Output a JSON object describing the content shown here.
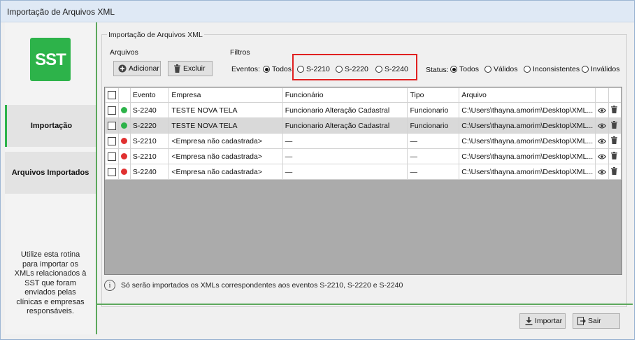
{
  "window": {
    "title": "Importação de Arquivos XML"
  },
  "sidebar": {
    "logo_text": "SST",
    "items": [
      {
        "label": "Importação",
        "active": true
      },
      {
        "label": "Arquivos Importados",
        "active": false
      }
    ],
    "help_lines": [
      "Utilize esta rotina",
      "para importar os",
      "XMLs relacionados à",
      "SST que foram",
      "enviados pelas",
      "clínicas e empresas",
      "responsáveis."
    ]
  },
  "group": {
    "title": "Importação de Arquivos XML",
    "arquivos_legend": "Arquivos",
    "filtros_legend": "Filtros",
    "add_label": "Adicionar",
    "delete_label": "Excluir",
    "eventos_label": "Eventos:",
    "eventos": [
      {
        "label": "Todos",
        "selected": true
      },
      {
        "label": "S-2210",
        "selected": false
      },
      {
        "label": "S-2220",
        "selected": false
      },
      {
        "label": "S-2240",
        "selected": false
      }
    ],
    "status_label": "Status:",
    "status": [
      {
        "label": "Todos",
        "selected": true
      },
      {
        "label": "Válidos",
        "selected": false
      },
      {
        "label": "Inconsistentes",
        "selected": false
      },
      {
        "label": "Inválidos",
        "selected": false
      }
    ]
  },
  "table": {
    "columns": [
      "Evento",
      "Empresa",
      "Funcionário",
      "Tipo",
      "Arquivo"
    ],
    "rows": [
      {
        "status": "green",
        "evento": "S-2240",
        "empresa": "TESTE NOVA TELA",
        "funcionario": "Funcionario Alteração Cadastral",
        "tipo": "Funcionario",
        "arquivo": "C:\\Users\\thayna.amorim\\Desktop\\XML...",
        "selected": false
      },
      {
        "status": "green",
        "evento": "S-2220",
        "empresa": "TESTE NOVA TELA",
        "funcionario": "Funcionario Alteração Cadastral",
        "tipo": "Funcionario",
        "arquivo": "C:\\Users\\thayna.amorim\\Desktop\\XML...",
        "selected": true
      },
      {
        "status": "red",
        "evento": "S-2210",
        "empresa": "<Empresa não cadastrada>",
        "funcionario": "—",
        "tipo": "—",
        "arquivo": "C:\\Users\\thayna.amorim\\Desktop\\XML...",
        "selected": false
      },
      {
        "status": "red",
        "evento": "S-2210",
        "empresa": "<Empresa não cadastrada>",
        "funcionario": "—",
        "tipo": "—",
        "arquivo": "C:\\Users\\thayna.amorim\\Desktop\\XML...",
        "selected": false
      },
      {
        "status": "red",
        "evento": "S-2240",
        "empresa": "<Empresa não cadastrada>",
        "funcionario": "—",
        "tipo": "—",
        "arquivo": "C:\\Users\\thayna.amorim\\Desktop\\XML...",
        "selected": false
      }
    ]
  },
  "info_text": "Só serão importados os XMLs correspondentes aos eventos S-2210, S-2220 e S-2240",
  "footer": {
    "import_label": "Importar",
    "exit_label": "Sair"
  },
  "colors": {
    "accent_green": "#2db34a",
    "error_red": "#e03030",
    "highlight_red": "#e02020"
  }
}
